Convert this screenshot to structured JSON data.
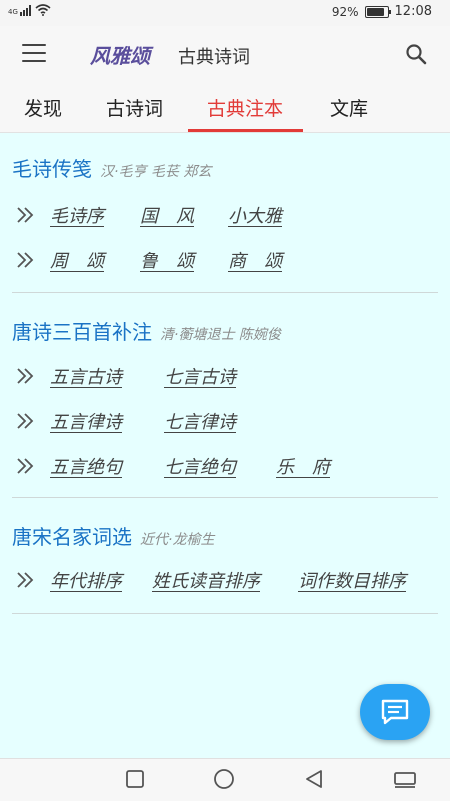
{
  "status_bar": {
    "network": "4G",
    "battery_percent": "92%",
    "battery_level": 0.92,
    "time": "12:08"
  },
  "app_bar": {
    "brand": "风雅颂",
    "subtitle": "古典诗词",
    "menu_icon": "hamburger-menu-icon",
    "search_icon": "search-icon"
  },
  "tabs": [
    {
      "label": "发现",
      "active": false
    },
    {
      "label": "古诗词",
      "active": false
    },
    {
      "label": "古典注本",
      "active": true
    },
    {
      "label": "文库",
      "active": false
    }
  ],
  "colors": {
    "accent": "#e23b38",
    "title_blue": "#1a73c5",
    "content_bg": "#e6ffff",
    "fab": "#2aa3f3"
  },
  "sections": [
    {
      "title": "毛诗传笺",
      "author": "汉·毛亨 毛苌 郑玄",
      "rows": [
        [
          "毛诗序",
          "国　风",
          "小大雅"
        ],
        [
          "周　颂",
          "鲁　颂",
          "商　颂"
        ]
      ]
    },
    {
      "title": "唐诗三百首补注",
      "author": "清·蘅塘退士 陈婉俊",
      "rows": [
        [
          "五言古诗",
          "七言古诗"
        ],
        [
          "五言律诗",
          "七言律诗"
        ],
        [
          "五言绝句",
          "七言绝句",
          "乐　府"
        ]
      ]
    },
    {
      "title": "唐宋名家词选",
      "author": "近代·龙榆生",
      "rows": [
        [
          "年代排序",
          "姓氏读音排序",
          "词作数目排序"
        ]
      ]
    }
  ],
  "fab": {
    "icon": "chat-message-icon"
  },
  "nav_bar": {
    "icons": [
      "recent-apps-icon",
      "home-icon",
      "back-icon",
      "keyboard-icon"
    ]
  }
}
